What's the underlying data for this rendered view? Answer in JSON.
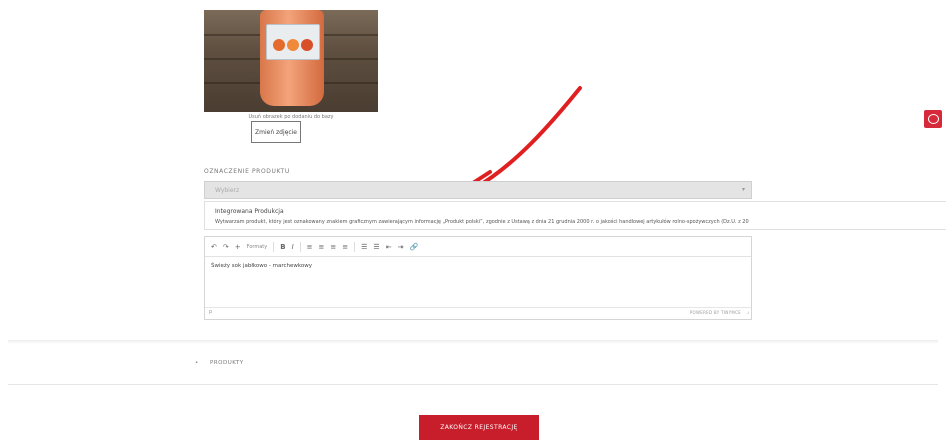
{
  "image": {
    "caption": "Usuń obrazek po dodaniu do bazy",
    "remove_button": "Zmień zdjęcie"
  },
  "marking": {
    "label": "OZNACZENIE PRODUKTU",
    "select_placeholder": "Wybierz",
    "option_title": "Integrowana Produkcja",
    "option_description": "Wytwarzam produkt, który jest oznakowany znakiem graficznym zawierającym informację „Produkt polski”, zgodnie z Ustawą z dnia 21 grudnia 2000 r. o jakości handlowej artykułów rolno-spożywczych (Dz.U. z 20"
  },
  "editor": {
    "toolbar": {
      "undo": "↶",
      "redo": "↷",
      "insert": "+",
      "formats": "Formaty",
      "bold": "B",
      "italic": "I",
      "align_left": "≡",
      "align_center": "≡",
      "align_right": "≡",
      "justify": "≡",
      "bullet_list": "☰",
      "numbered_list": "☰",
      "outdent": "⇤",
      "indent": "⇥",
      "link": "🔗"
    },
    "content": "Świeży sok jabłkowo - marchewkowy",
    "statusbar_path": "p",
    "powered_by": "POWERED BY TINYMCE"
  },
  "products_section": {
    "label": "PRODUKTY"
  },
  "finish_button": "ZAKOŃCZ REJESTRACJĘ",
  "colors": {
    "accent": "#c81e2c",
    "annotation_arrow": "#e02020"
  }
}
